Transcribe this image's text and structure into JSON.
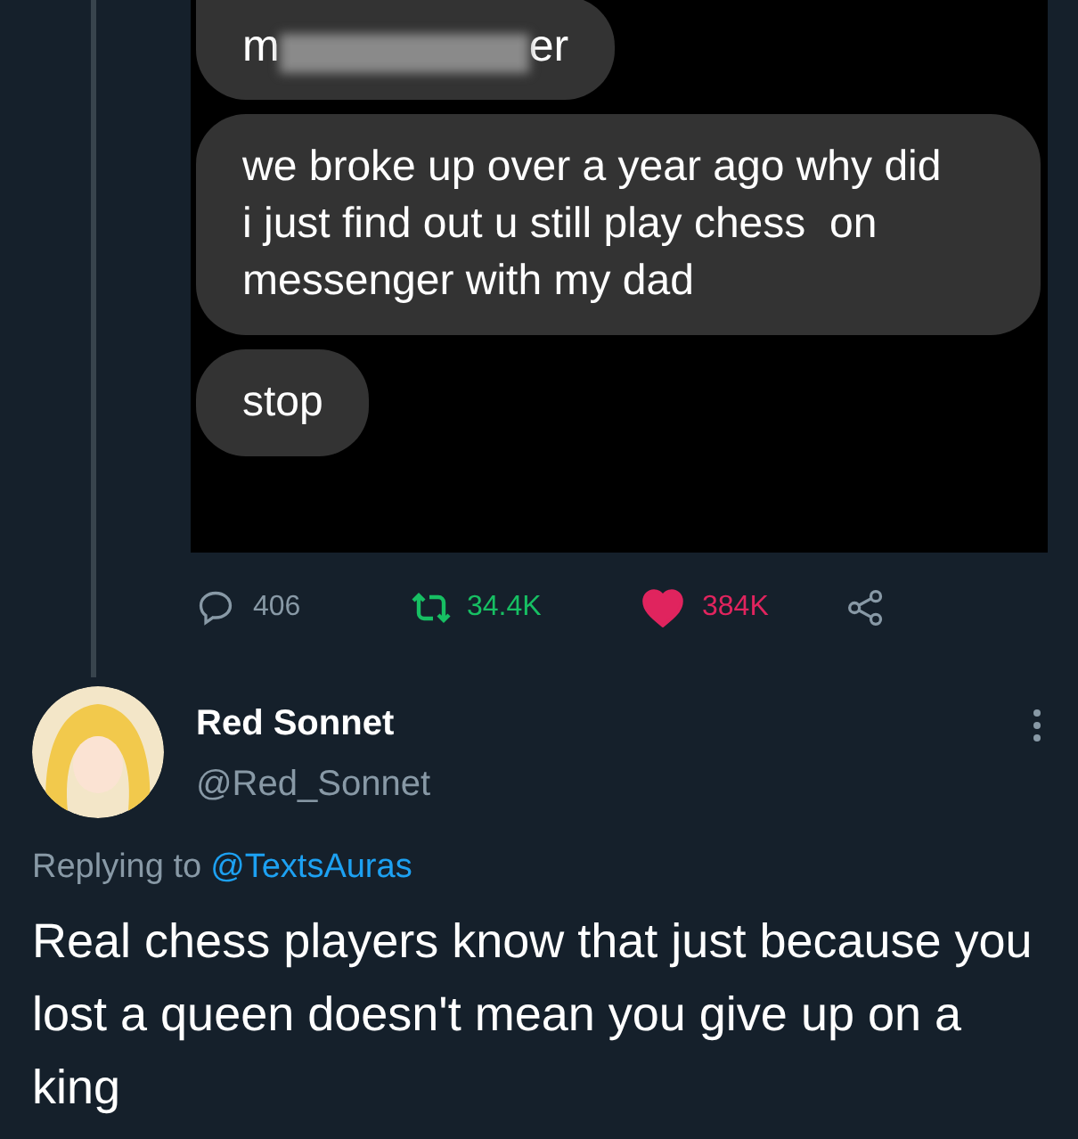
{
  "chat_screenshot": {
    "messages": [
      {
        "kind": "censored",
        "start": "m",
        "end": "er"
      },
      {
        "kind": "text",
        "text": "we broke up over a year ago why did i just find out u still play chess  on messenger with my dad"
      },
      {
        "kind": "text",
        "text": "stop"
      }
    ]
  },
  "actions": {
    "replies": "406",
    "retweets": "34.4K",
    "likes": "384K",
    "liked": true
  },
  "reply": {
    "name": "Red Sonnet",
    "handle": "@Red_Sonnet",
    "replying_label": "Replying to",
    "replying_to": "@TextsAuras",
    "text": "Real chess players know that just because you lost a queen doesn't mean you give up on a king"
  }
}
